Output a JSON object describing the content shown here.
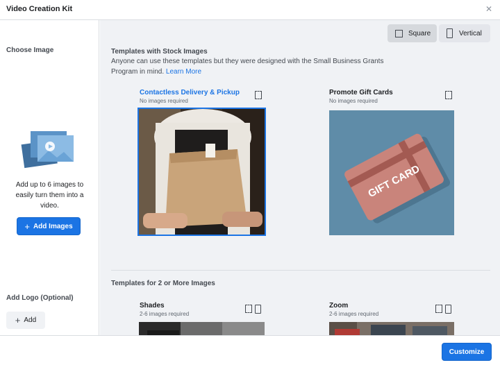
{
  "window": {
    "title": "Video Creation Kit",
    "close_glyph": "✕"
  },
  "sidebar": {
    "choose_heading": "Choose Image",
    "description": "Add up to 6 images to easily turn them into a video.",
    "add_images_label": "Add Images",
    "logo_heading": "Add Logo (Optional)",
    "add_logo_label": "Add"
  },
  "toggles": {
    "square_label": "Square",
    "vertical_label": "Vertical",
    "selected": "Square"
  },
  "section_stock": {
    "title": "Templates with Stock Images",
    "description": "Anyone can use these templates but they were designed with the Small Business Grants Program in mind.",
    "learn_more": "Learn More",
    "cards": [
      {
        "title": "Contactless Delivery & Pickup",
        "subtitle": "No images required",
        "selected": true
      },
      {
        "title": "Promote Gift Cards",
        "subtitle": "No images required",
        "selected": false,
        "image_text": "GIFT CARD"
      }
    ]
  },
  "section_multi": {
    "title": "Templates for 2 or More Images",
    "cards": [
      {
        "title": "Shades",
        "subtitle": "2-6 images required"
      },
      {
        "title": "Zoom",
        "subtitle": "2-6 images required"
      }
    ]
  },
  "footer": {
    "customize_label": "Customize"
  },
  "colors": {
    "accent": "#1b74e4",
    "panel_bg": "#f0f2f5",
    "gift_card": "#c9847b",
    "gift_bg": "#5d8aa6"
  }
}
